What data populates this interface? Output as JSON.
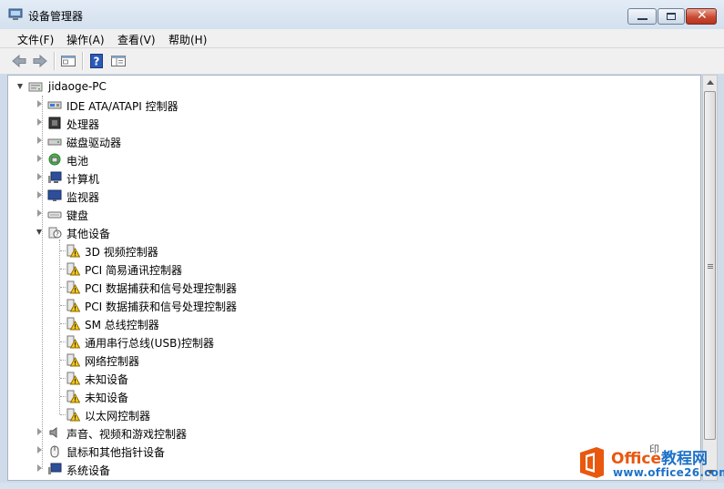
{
  "window": {
    "title": "设备管理器"
  },
  "menu": [
    "文件(F)",
    "操作(A)",
    "查看(V)",
    "帮助(H)"
  ],
  "toolbar": {
    "icons": [
      "back-arrow-icon",
      "forward-arrow-icon",
      "properties-icon",
      "help-icon",
      "show-hide-tree-icon"
    ]
  },
  "tree": {
    "root": "jidaoge-PC",
    "categories_top": [
      "IDE ATA/ATAPI 控制器",
      "处理器",
      "磁盘驱动器",
      "电池",
      "计算机",
      "监视器",
      "键盘"
    ],
    "expanded": {
      "label": "其他设备",
      "children": [
        "3D 视频控制器",
        "PCI 简易通讯控制器",
        "PCI 数据捕获和信号处理控制器",
        "PCI 数据捕获和信号处理控制器",
        "SM 总线控制器",
        "通用串行总线(USB)控制器",
        "网络控制器",
        "未知设备",
        "未知设备",
        "以太网控制器"
      ]
    },
    "categories_bottom": [
      "声音、视频和游戏控制器",
      "鼠标和其他指针设备",
      "系统设备"
    ]
  },
  "watermark": {
    "brand_a": "Office",
    "brand_b": "教程网",
    "url": "www.office26.com",
    "hidden": "印"
  },
  "colors": {
    "warning": "#f5c518",
    "title_bg": "#d9e4f1",
    "close": "#c94b34"
  }
}
